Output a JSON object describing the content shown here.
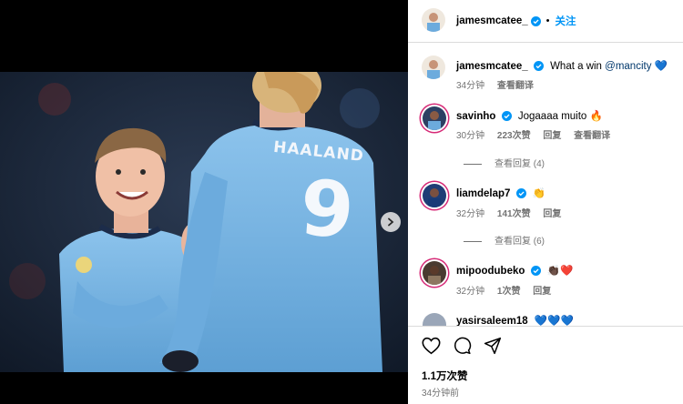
{
  "post": {
    "author": "jamesmcatee_",
    "follow_label": "关注",
    "separator": "•",
    "caption": {
      "username": "jamesmcatee_",
      "text": "What a win",
      "mention": "@mancity",
      "emoji": "💙",
      "time": "34分钟",
      "translate": "查看翻译"
    },
    "jersey_name": "HAALAND",
    "jersey_number": "9",
    "likes": "1.1万次赞",
    "posted": "34分钟前"
  },
  "comments": [
    {
      "username": "savinho",
      "verified": true,
      "text": "Jogaaaa muito",
      "emoji": "🔥",
      "time": "30分钟",
      "likes": "223次赞",
      "reply": "回复",
      "translate": "查看翻译",
      "view_replies": "查看回复 (4)"
    },
    {
      "username": "liamdelap7",
      "verified": true,
      "text": "",
      "emoji": "👏",
      "time": "32分钟",
      "likes": "141次赞",
      "reply": "回复",
      "view_replies": "查看回复 (6)"
    },
    {
      "username": "mipoodubeko",
      "verified": true,
      "text": "",
      "emoji": "👏🏿❤️",
      "time": "32分钟",
      "likes": "1次赞",
      "reply": "回复"
    },
    {
      "username": "yasirsaleem18",
      "verified": false,
      "text": "",
      "emoji": "💙💙💙"
    }
  ],
  "icons": [
    "heart-icon",
    "comment-icon",
    "share-icon",
    "chevron-right-icon",
    "verified-icon"
  ],
  "colors": {
    "accent": "#0095f6",
    "ring": "#d62976",
    "city_blue": "#6cabdd"
  }
}
